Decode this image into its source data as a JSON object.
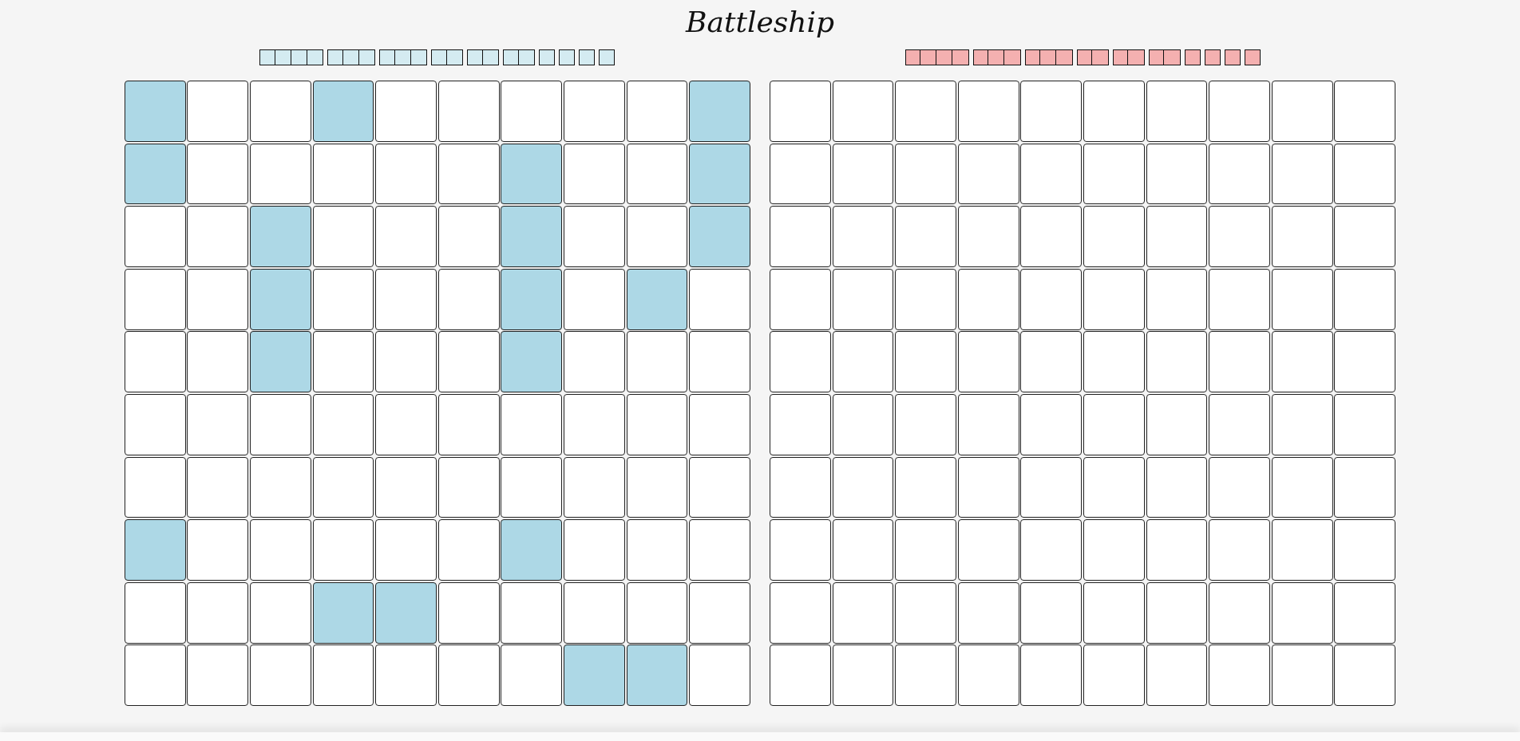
{
  "title": "Battleship",
  "boards": [
    {
      "color": "#d4ebf1",
      "fleet": [
        {
          "segments": [
            {
              "hit": false
            },
            {
              "hit": false
            },
            {
              "hit": false
            },
            {
              "hit": false
            }
          ]
        },
        {
          "segments": [
            {
              "hit": false
            },
            {
              "hit": false
            },
            {
              "hit": false
            }
          ]
        },
        {
          "segments": [
            {
              "hit": false
            },
            {
              "hit": false
            },
            {
              "hit": false
            }
          ]
        },
        {
          "segments": [
            {
              "hit": false
            },
            {
              "hit": false
            }
          ]
        },
        {
          "segments": [
            {
              "hit": false
            },
            {
              "hit": false
            }
          ]
        },
        {
          "segments": [
            {
              "hit": false
            },
            {
              "hit": false
            }
          ]
        },
        {
          "segments": [
            {
              "hit": false
            }
          ]
        },
        {
          "segments": [
            {
              "hit": false
            }
          ]
        },
        {
          "segments": [
            {
              "hit": false
            }
          ]
        },
        {
          "segments": [
            {
              "hit": false
            }
          ]
        }
      ],
      "rows": [
        [
          {
            "ship": true
          },
          {
            "ship": false
          },
          {
            "ship": false
          },
          {
            "ship": true
          },
          {
            "ship": false
          },
          {
            "ship": false
          },
          {
            "ship": false
          },
          {
            "ship": false
          },
          {
            "ship": false
          },
          {
            "ship": true
          }
        ],
        [
          {
            "ship": true
          },
          {
            "ship": false
          },
          {
            "ship": false
          },
          {
            "ship": false
          },
          {
            "ship": false
          },
          {
            "ship": false
          },
          {
            "ship": true
          },
          {
            "ship": false
          },
          {
            "ship": false
          },
          {
            "ship": true
          }
        ],
        [
          {
            "ship": false
          },
          {
            "ship": false
          },
          {
            "ship": true
          },
          {
            "ship": false
          },
          {
            "ship": false
          },
          {
            "ship": false
          },
          {
            "ship": true
          },
          {
            "ship": false
          },
          {
            "ship": false
          },
          {
            "ship": true
          }
        ],
        [
          {
            "ship": false
          },
          {
            "ship": false
          },
          {
            "ship": true
          },
          {
            "ship": false
          },
          {
            "ship": false
          },
          {
            "ship": false
          },
          {
            "ship": true
          },
          {
            "ship": false
          },
          {
            "ship": true
          },
          {
            "ship": false
          }
        ],
        [
          {
            "ship": false
          },
          {
            "ship": false
          },
          {
            "ship": true
          },
          {
            "ship": false
          },
          {
            "ship": false
          },
          {
            "ship": false
          },
          {
            "ship": true
          },
          {
            "ship": false
          },
          {
            "ship": false
          },
          {
            "ship": false
          }
        ],
        [
          {
            "ship": false
          },
          {
            "ship": false
          },
          {
            "ship": false
          },
          {
            "ship": false
          },
          {
            "ship": false
          },
          {
            "ship": false
          },
          {
            "ship": false
          },
          {
            "ship": false
          },
          {
            "ship": false
          },
          {
            "ship": false
          }
        ],
        [
          {
            "ship": false
          },
          {
            "ship": false
          },
          {
            "ship": false
          },
          {
            "ship": false
          },
          {
            "ship": false
          },
          {
            "ship": false
          },
          {
            "ship": false
          },
          {
            "ship": false
          },
          {
            "ship": false
          },
          {
            "ship": false
          }
        ],
        [
          {
            "ship": true
          },
          {
            "ship": false
          },
          {
            "ship": false
          },
          {
            "ship": false
          },
          {
            "ship": false
          },
          {
            "ship": false
          },
          {
            "ship": true
          },
          {
            "ship": false
          },
          {
            "ship": false
          },
          {
            "ship": false
          }
        ],
        [
          {
            "ship": false
          },
          {
            "ship": false
          },
          {
            "ship": false
          },
          {
            "ship": true
          },
          {
            "ship": true
          },
          {
            "ship": false
          },
          {
            "ship": false
          },
          {
            "ship": false
          },
          {
            "ship": false
          },
          {
            "ship": false
          }
        ],
        [
          {
            "ship": false
          },
          {
            "ship": false
          },
          {
            "ship": false
          },
          {
            "ship": false
          },
          {
            "ship": false
          },
          {
            "ship": false
          },
          {
            "ship": false
          },
          {
            "ship": true
          },
          {
            "ship": true
          },
          {
            "ship": false
          }
        ]
      ]
    },
    {
      "color": "#f4b0b0",
      "fleet": [
        {
          "segments": [
            {
              "hit": false
            },
            {
              "hit": false
            },
            {
              "hit": false
            },
            {
              "hit": false
            }
          ]
        },
        {
          "segments": [
            {
              "hit": false
            },
            {
              "hit": false
            },
            {
              "hit": false
            }
          ]
        },
        {
          "segments": [
            {
              "hit": false
            },
            {
              "hit": false
            },
            {
              "hit": false
            }
          ]
        },
        {
          "segments": [
            {
              "hit": false
            },
            {
              "hit": false
            }
          ]
        },
        {
          "segments": [
            {
              "hit": false
            },
            {
              "hit": false
            }
          ]
        },
        {
          "segments": [
            {
              "hit": false
            },
            {
              "hit": false
            }
          ]
        },
        {
          "segments": [
            {
              "hit": false
            }
          ]
        },
        {
          "segments": [
            {
              "hit": false
            }
          ]
        },
        {
          "segments": [
            {
              "hit": false
            }
          ]
        },
        {
          "segments": [
            {
              "hit": false
            }
          ]
        }
      ],
      "rows": [
        [
          {
            "ship": false
          },
          {
            "ship": false
          },
          {
            "ship": false
          },
          {
            "ship": false
          },
          {
            "ship": false
          },
          {
            "ship": false
          },
          {
            "ship": false
          },
          {
            "ship": false
          },
          {
            "ship": false
          },
          {
            "ship": false
          }
        ],
        [
          {
            "ship": false
          },
          {
            "ship": false
          },
          {
            "ship": false
          },
          {
            "ship": false
          },
          {
            "ship": false
          },
          {
            "ship": false
          },
          {
            "ship": false
          },
          {
            "ship": false
          },
          {
            "ship": false
          },
          {
            "ship": false
          }
        ],
        [
          {
            "ship": false
          },
          {
            "ship": false
          },
          {
            "ship": false
          },
          {
            "ship": false
          },
          {
            "ship": false
          },
          {
            "ship": false
          },
          {
            "ship": false
          },
          {
            "ship": false
          },
          {
            "ship": false
          },
          {
            "ship": false
          }
        ],
        [
          {
            "ship": false
          },
          {
            "ship": false
          },
          {
            "ship": false
          },
          {
            "ship": false
          },
          {
            "ship": false
          },
          {
            "ship": false
          },
          {
            "ship": false
          },
          {
            "ship": false
          },
          {
            "ship": false
          },
          {
            "ship": false
          }
        ],
        [
          {
            "ship": false
          },
          {
            "ship": false
          },
          {
            "ship": false
          },
          {
            "ship": false
          },
          {
            "ship": false
          },
          {
            "ship": false
          },
          {
            "ship": false
          },
          {
            "ship": false
          },
          {
            "ship": false
          },
          {
            "ship": false
          }
        ],
        [
          {
            "ship": false
          },
          {
            "ship": false
          },
          {
            "ship": false
          },
          {
            "ship": false
          },
          {
            "ship": false
          },
          {
            "ship": false
          },
          {
            "ship": false
          },
          {
            "ship": false
          },
          {
            "ship": false
          },
          {
            "ship": false
          }
        ],
        [
          {
            "ship": false
          },
          {
            "ship": false
          },
          {
            "ship": false
          },
          {
            "ship": false
          },
          {
            "ship": false
          },
          {
            "ship": false
          },
          {
            "ship": false
          },
          {
            "ship": false
          },
          {
            "ship": false
          },
          {
            "ship": false
          }
        ],
        [
          {
            "ship": false
          },
          {
            "ship": false
          },
          {
            "ship": false
          },
          {
            "ship": false
          },
          {
            "ship": false
          },
          {
            "ship": false
          },
          {
            "ship": false
          },
          {
            "ship": false
          },
          {
            "ship": false
          },
          {
            "ship": false
          }
        ],
        [
          {
            "ship": false
          },
          {
            "ship": false
          },
          {
            "ship": false
          },
          {
            "ship": false
          },
          {
            "ship": false
          },
          {
            "ship": false
          },
          {
            "ship": false
          },
          {
            "ship": false
          },
          {
            "ship": false
          },
          {
            "ship": false
          }
        ],
        [
          {
            "ship": false
          },
          {
            "ship": false
          },
          {
            "ship": false
          },
          {
            "ship": false
          },
          {
            "ship": false
          },
          {
            "ship": false
          },
          {
            "ship": false
          },
          {
            "ship": false
          },
          {
            "ship": false
          },
          {
            "ship": false
          }
        ]
      ]
    }
  ]
}
